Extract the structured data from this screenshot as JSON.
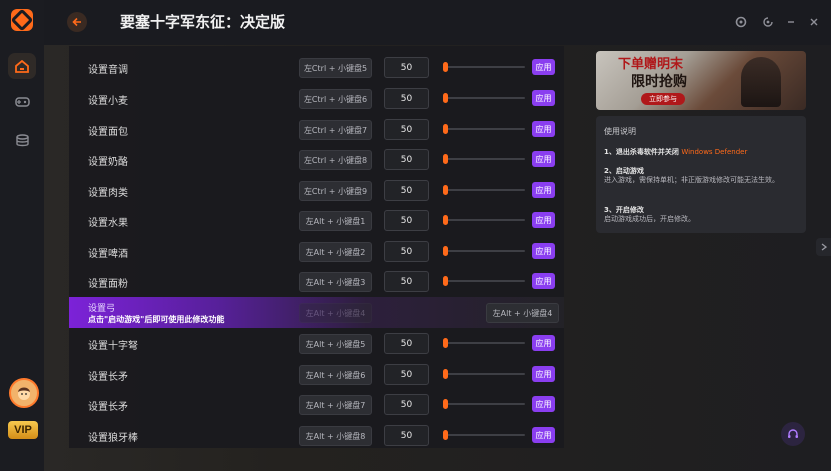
{
  "app": {
    "title": "要塞十字军东征：决定版",
    "back_icon": "arrow-left-icon",
    "accent_color": "#ff6a1a",
    "apply_color": "#8a3ef0"
  },
  "sidebar": {
    "items": [
      {
        "name": "home",
        "icon": "home-icon",
        "active": true
      },
      {
        "name": "games",
        "icon": "gamepad-icon",
        "active": false
      },
      {
        "name": "library",
        "icon": "database-icon",
        "active": false
      }
    ],
    "vip_label": "VIP"
  },
  "window_controls": [
    "settings-icon",
    "pin-icon",
    "minimize-icon",
    "close-icon"
  ],
  "rows": [
    {
      "label": "设置音调",
      "hotkey": "左Ctrl + 小键盘5",
      "value": "50",
      "apply": "应用"
    },
    {
      "label": "设置小麦",
      "hotkey": "左Ctrl + 小键盘6",
      "value": "50",
      "apply": "应用"
    },
    {
      "label": "设置面包",
      "hotkey": "左Ctrl + 小键盘7",
      "value": "50",
      "apply": "应用"
    },
    {
      "label": "设置奶酪",
      "hotkey": "左Ctrl + 小键盘8",
      "value": "50",
      "apply": "应用"
    },
    {
      "label": "设置肉类",
      "hotkey": "左Ctrl + 小键盘9",
      "value": "50",
      "apply": "应用"
    },
    {
      "label": "设置水果",
      "hotkey": "左Alt + 小键盘1",
      "value": "50",
      "apply": "应用"
    },
    {
      "label": "设置啤酒",
      "hotkey": "左Alt + 小键盘2",
      "value": "50",
      "apply": "应用"
    },
    {
      "label": "设置面粉",
      "hotkey": "左Alt + 小键盘3",
      "value": "50",
      "apply": "应用"
    }
  ],
  "locked_row": {
    "label": "设置弓",
    "hint": "点击\"启动游戏\"后即可使用此修改功能",
    "hotkey_faded": "左Alt + 小键盘4",
    "hotkey": "左Alt + 小键盘4"
  },
  "rows_after": [
    {
      "label": "设置十字弩",
      "hotkey": "左Alt + 小键盘5",
      "value": "50",
      "apply": "应用"
    },
    {
      "label": "设置长矛",
      "hotkey": "左Alt + 小键盘6",
      "value": "50",
      "apply": "应用"
    },
    {
      "label": "设置长矛",
      "hotkey": "左Alt + 小键盘7",
      "value": "50",
      "apply": "应用"
    },
    {
      "label": "设置狼牙棒",
      "hotkey": "左Alt + 小键盘8",
      "value": "50",
      "apply": "应用"
    }
  ],
  "slider_level": 0,
  "banner": {
    "line1": "下单赠明末",
    "line2": "限时抢购",
    "tag": "立即参与"
  },
  "instructions": {
    "heading": "使用说明",
    "step1_title": "1、退出杀毒软件并关闭",
    "step1_highlight": "Windows Defender",
    "step2_title": "2、启动游戏",
    "step2_text": "进入游戏，需保持单机；非正版游戏修改可能无法生效。",
    "step3_title": "3、开启修改",
    "step3_text": "启动游戏成功后，开启修改。"
  }
}
